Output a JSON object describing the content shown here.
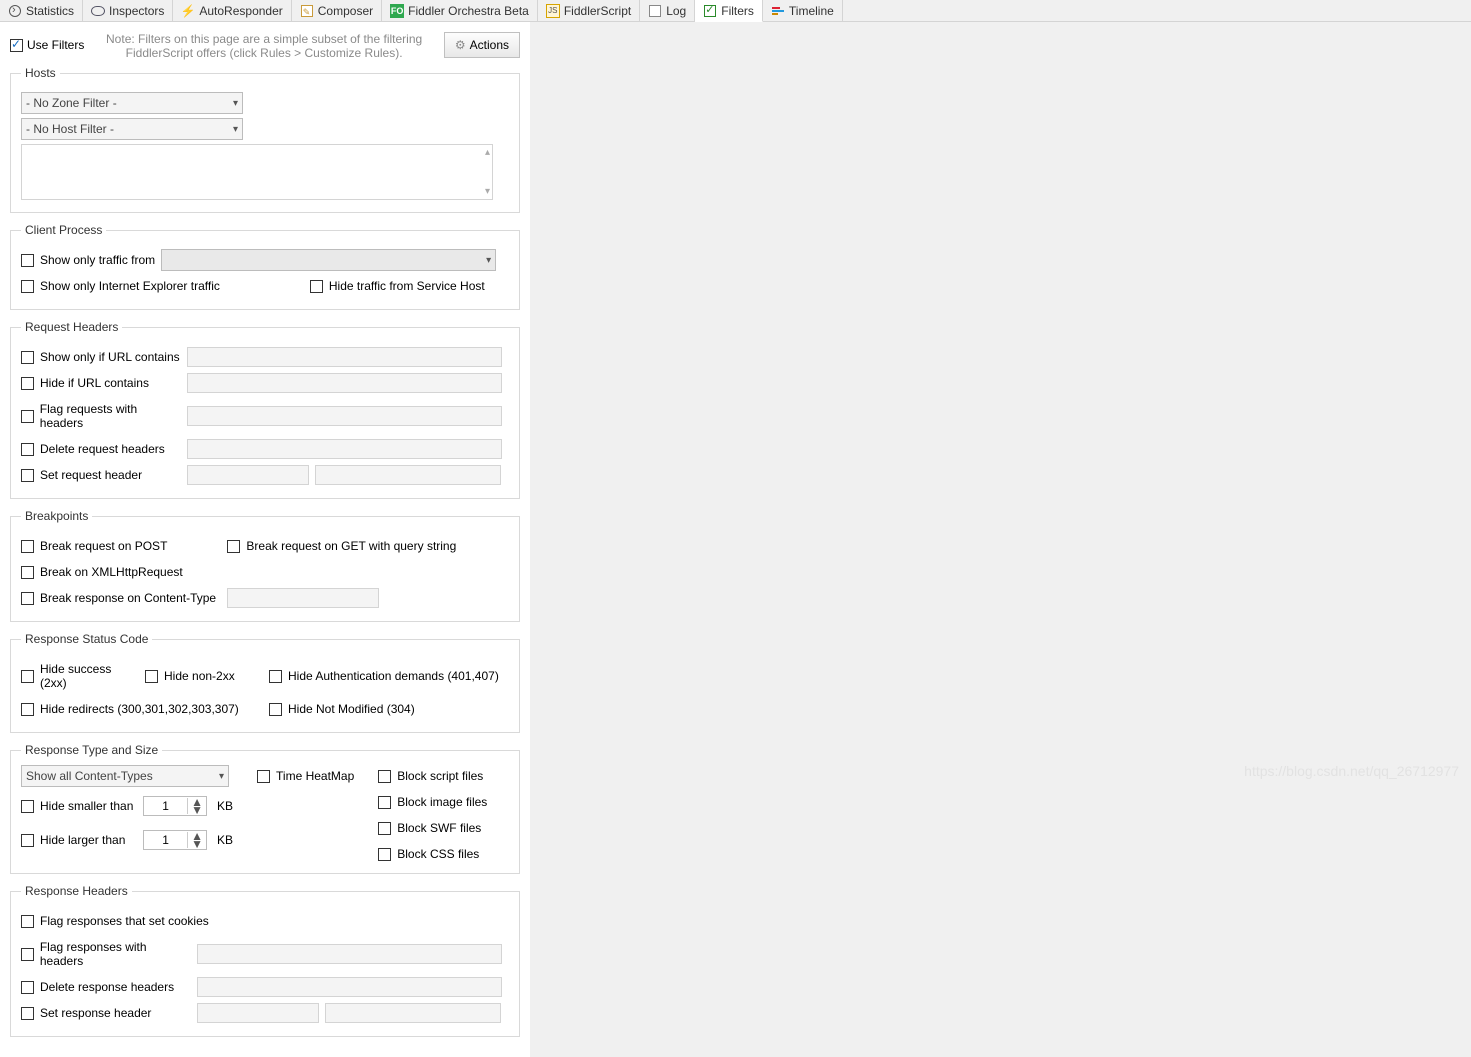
{
  "tabs": [
    {
      "label": "Statistics"
    },
    {
      "label": "Inspectors"
    },
    {
      "label": "AutoResponder"
    },
    {
      "label": "Composer"
    },
    {
      "label": "Fiddler Orchestra Beta"
    },
    {
      "label": "FiddlerScript"
    },
    {
      "label": "Log"
    },
    {
      "label": "Filters"
    },
    {
      "label": "Timeline"
    }
  ],
  "top": {
    "useFilters": "Use Filters",
    "note1": "Note: Filters on this page are a simple subset of the filtering",
    "note2": "FiddlerScript offers (click Rules > Customize Rules).",
    "actions": "Actions"
  },
  "hosts": {
    "legend": "Hosts",
    "zone": "- No Zone Filter -",
    "host": "- No Host Filter -"
  },
  "client": {
    "legend": "Client Process",
    "from": "Show only traffic from",
    "ie": "Show only Internet Explorer traffic",
    "svc": "Hide traffic from Service Host"
  },
  "reqh": {
    "legend": "Request Headers",
    "urlcontains": "Show only if URL contains",
    "hideurl": "Hide if URL contains",
    "flag": "Flag requests with headers",
    "del": "Delete request headers",
    "set": "Set request header"
  },
  "bp": {
    "legend": "Breakpoints",
    "post": "Break request on POST",
    "getq": "Break request on GET with query string",
    "xhr": "Break on XMLHttpRequest",
    "ct": "Break response on Content-Type"
  },
  "status": {
    "legend": "Response Status Code",
    "h2xx": "Hide success (2xx)",
    "hnon2": "Hide non-2xx",
    "hauth": "Hide Authentication demands (401,407)",
    "hredir": "Hide redirects (300,301,302,303,307)",
    "h304": "Hide Not Modified (304)"
  },
  "typesize": {
    "legend": "Response Type and Size",
    "ctdd": "Show all Content-Types",
    "hsmall": "Hide smaller than",
    "hlarge": "Hide larger than",
    "v1": "1",
    "v2": "1",
    "unit": "KB",
    "heat": "Time HeatMap",
    "bscript": "Block script files",
    "bimg": "Block image files",
    "bswf": "Block SWF files",
    "bcss": "Block CSS files"
  },
  "resph": {
    "legend": "Response Headers",
    "cookies": "Flag responses that set cookies",
    "flag": "Flag responses with headers",
    "del": "Delete response headers",
    "set": "Set response header"
  },
  "watermark": "https://blog.csdn.net/qq_26712977"
}
